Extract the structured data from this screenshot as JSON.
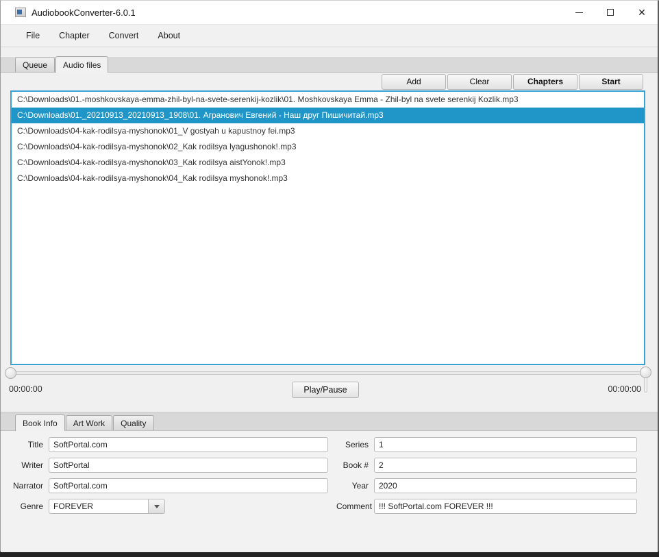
{
  "window": {
    "title": "AudiobookConverter-6.0.1",
    "controls": {
      "minimize": "minimize",
      "maximize": "maximize",
      "close": "✕"
    }
  },
  "menu": {
    "items": [
      "File",
      "Chapter",
      "Convert",
      "About"
    ]
  },
  "tabs_top": {
    "items": [
      "Queue",
      "Audio files"
    ],
    "selected": "Audio files"
  },
  "toolbar": {
    "add_label": "Add",
    "clear_label": "Clear",
    "chapters_label": "Chapters",
    "start_label": "Start"
  },
  "file_list": {
    "selected_index": 1,
    "files": [
      "C:\\Downloads\\01.-moshkovskaya-emma-zhil-byl-na-svete-serenkij-kozlik\\01. Moshkovskaya Emma - Zhil-byl na svete serenkij Kozlik.mp3",
      "C:\\Downloads\\01._20210913_20210913_1908\\01. Агранович Евгений - Наш друг Пишичитай.mp3",
      "C:\\Downloads\\04-kak-rodilsya-myshonok\\01_V gostyah u kapustnoy fei.mp3",
      "C:\\Downloads\\04-kak-rodilsya-myshonok\\02_Kak rodilsya lyagushonok!.mp3",
      "C:\\Downloads\\04-kak-rodilsya-myshonok\\03_Kak rodilsya aistYonok!.mp3",
      "C:\\Downloads\\04-kak-rodilsya-myshonok\\04_Kak rodilsya myshonok!.mp3"
    ]
  },
  "player": {
    "elapsed": "00:00:00",
    "remaining": "00:00:00",
    "play_pause_label": "Play/Pause"
  },
  "tabs_bottom": {
    "items": [
      "Book Info",
      "Art Work",
      "Quality"
    ],
    "selected": "Book Info"
  },
  "book_info": {
    "title": {
      "label": "Title",
      "value": "SoftPortal.com"
    },
    "writer": {
      "label": "Writer",
      "value": "SoftPortal"
    },
    "narrator": {
      "label": "Narrator",
      "value": "SoftPortal.com"
    },
    "genre": {
      "label": "Genre",
      "value": "FOREVER"
    },
    "series": {
      "label": "Series",
      "value": "1"
    },
    "book_no": {
      "label": "Book #",
      "value": "2"
    },
    "year": {
      "label": "Year",
      "value": "2020"
    },
    "comment": {
      "label": "Comment",
      "value": "!!! SoftPortal.com FOREVER !!!"
    }
  },
  "colors": {
    "selection": "#2095c8",
    "list_border": "#38a3d2"
  }
}
